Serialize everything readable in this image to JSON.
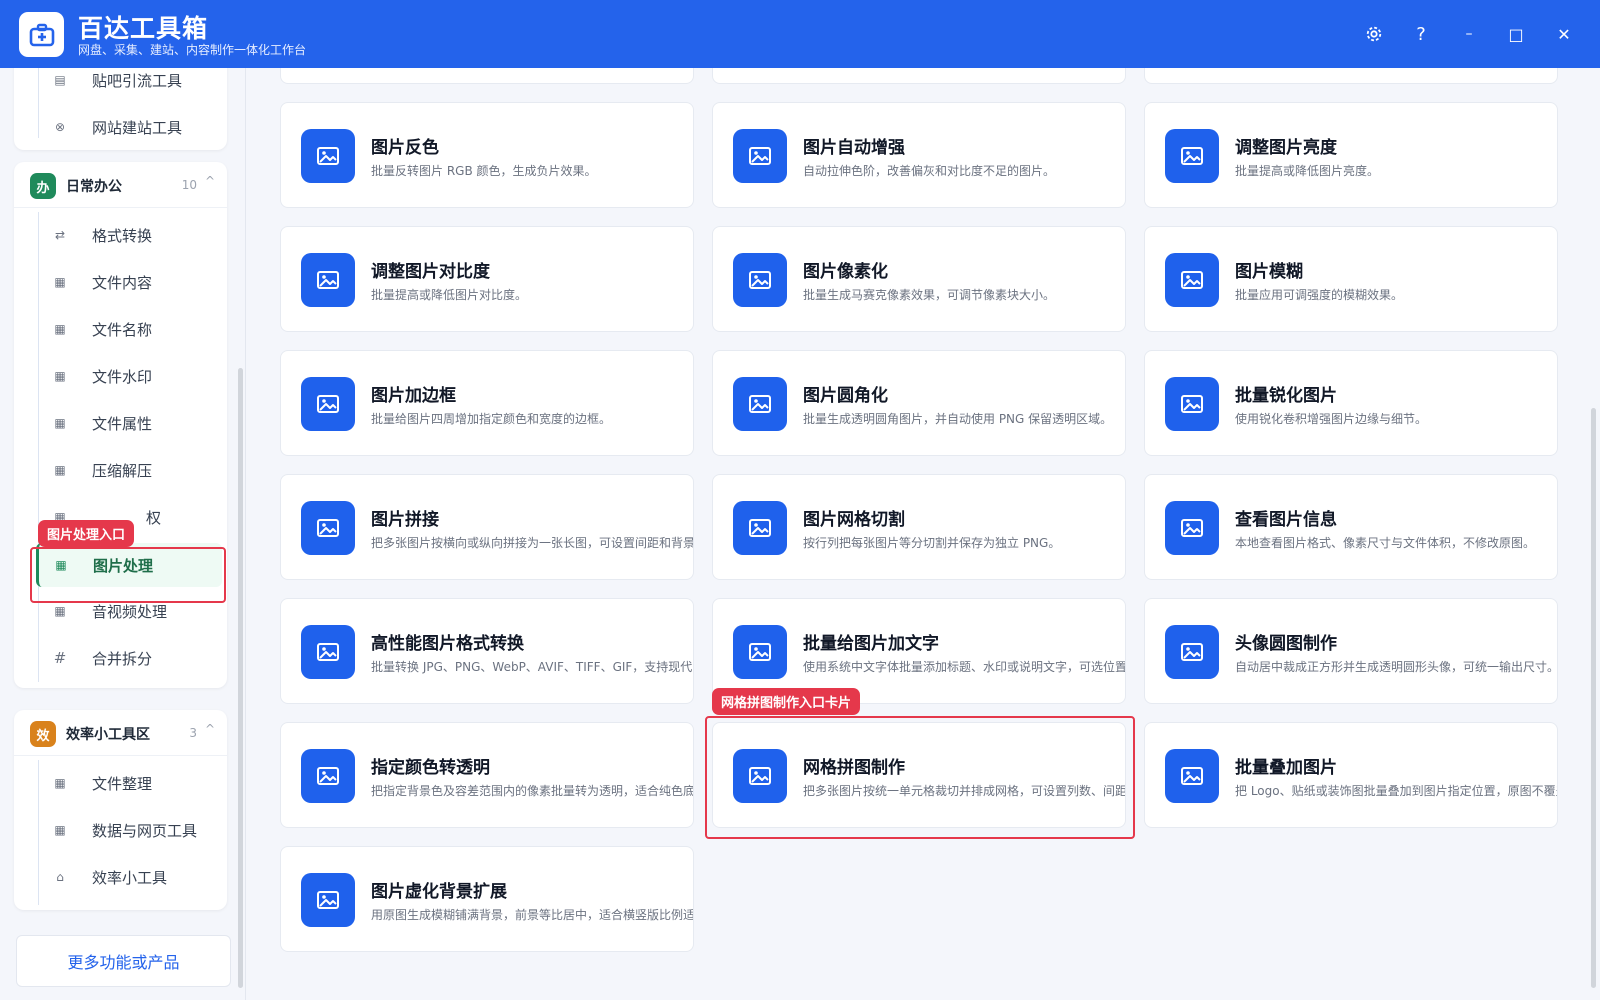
{
  "app": {
    "title": "百达工具箱",
    "subtitle": "网盘、采集、建站、内容制作一体化工作台",
    "settings_icon": "gear-icon",
    "help_label": "?",
    "minimize_label": "–",
    "maximize_label": "□",
    "close_label": "✕"
  },
  "sidebar": {
    "top_group_items": [
      {
        "label": "贴吧引流工具",
        "icon": "doc-icon"
      },
      {
        "label": "网站建站工具",
        "icon": "globe-icon"
      }
    ],
    "office_group": {
      "badge": "办",
      "badge_color": "#1f8a5b",
      "title": "日常办公",
      "count": "10",
      "chevron": "^",
      "items": [
        {
          "label": "格式转换",
          "icon": "swap-icon"
        },
        {
          "label": "文件内容",
          "icon": "grid-icon"
        },
        {
          "label": "文件名称",
          "icon": "grid-icon"
        },
        {
          "label": "文件水印",
          "icon": "grid-icon"
        },
        {
          "label": "文件属性",
          "icon": "grid-icon"
        },
        {
          "label": "压缩解压",
          "icon": "grid-icon"
        },
        {
          "label": "权",
          "icon": "grid-icon"
        },
        {
          "label": "图片处理",
          "icon": "grid-icon",
          "active": true
        },
        {
          "label": "音视频处理",
          "icon": "grid-icon"
        },
        {
          "label": "合并拆分",
          "icon": "hash-icon"
        }
      ]
    },
    "efficiency_group": {
      "badge": "效",
      "badge_color": "#d9821c",
      "title": "效率小工具区",
      "count": "3",
      "chevron": "^",
      "items": [
        {
          "label": "文件整理",
          "icon": "grid-icon"
        },
        {
          "label": "数据与网页工具",
          "icon": "grid-icon"
        },
        {
          "label": "效率小工具",
          "icon": "toolbox-icon"
        }
      ]
    },
    "more_button": "更多功能或产品"
  },
  "annotations": {
    "sidebar_tag": "图片处理入口",
    "card_tag": "网格拼图制作入口卡片",
    "color": "#e5384b"
  },
  "cards": [
    {
      "title": "图片反色",
      "desc": "批量反转图片 RGB 颜色，生成负片效果。"
    },
    {
      "title": "图片自动增强",
      "desc": "自动拉伸色阶，改善偏灰和对比度不足的图片。"
    },
    {
      "title": "调整图片亮度",
      "desc": "批量提高或降低图片亮度。"
    },
    {
      "title": "调整图片对比度",
      "desc": "批量提高或降低图片对比度。"
    },
    {
      "title": "图片像素化",
      "desc": "批量生成马赛克像素效果，可调节像素块大小。"
    },
    {
      "title": "图片模糊",
      "desc": "批量应用可调强度的模糊效果。"
    },
    {
      "title": "图片加边框",
      "desc": "批量给图片四周增加指定颜色和宽度的边框。"
    },
    {
      "title": "图片圆角化",
      "desc": "批量生成透明圆角图片，并自动使用 PNG 保留透明区域。"
    },
    {
      "title": "批量锐化图片",
      "desc": "使用锐化卷积增强图片边缘与细节。"
    },
    {
      "title": "图片拼接",
      "desc": "把多张图片按横向或纵向拼接为一张长图，可设置间距和背景色。"
    },
    {
      "title": "图片网格切割",
      "desc": "按行列把每张图片等分切割并保存为独立 PNG。"
    },
    {
      "title": "查看图片信息",
      "desc": "本地查看图片格式、像素尺寸与文件体积，不修改原图。"
    },
    {
      "title": "高性能图片格式转换",
      "desc": "批量转换 JPG、PNG、WebP、AVIF、TIFF、GIF，支持现代图片"
    },
    {
      "title": "批量给图片加文字",
      "desc": "使用系统中文字体批量添加标题、水印或说明文字，可选位置、字"
    },
    {
      "title": "头像圆图制作",
      "desc": "自动居中裁成正方形并生成透明圆形头像，可统一输出尺寸。"
    },
    {
      "title": "指定颜色转透明",
      "desc": "把指定背景色及容差范围内的像素批量转为透明，适合纯色底素材"
    },
    {
      "title": "网格拼图制作",
      "desc": "把多张图片按统一单元格裁切并排成网格，可设置列数、间距和背"
    },
    {
      "title": "批量叠加图片",
      "desc": "把 Logo、贴纸或装饰图批量叠加到图片指定位置，原图不覆盖。"
    },
    {
      "title": "图片虚化背景扩展",
      "desc": "用原图生成模糊铺满背景，前景等比居中，适合横竖版比例适配。"
    }
  ],
  "colors": {
    "titlebar": "#2463eb",
    "card_icon": "#1f61ec",
    "active_item_bg": "#eefaf4"
  }
}
